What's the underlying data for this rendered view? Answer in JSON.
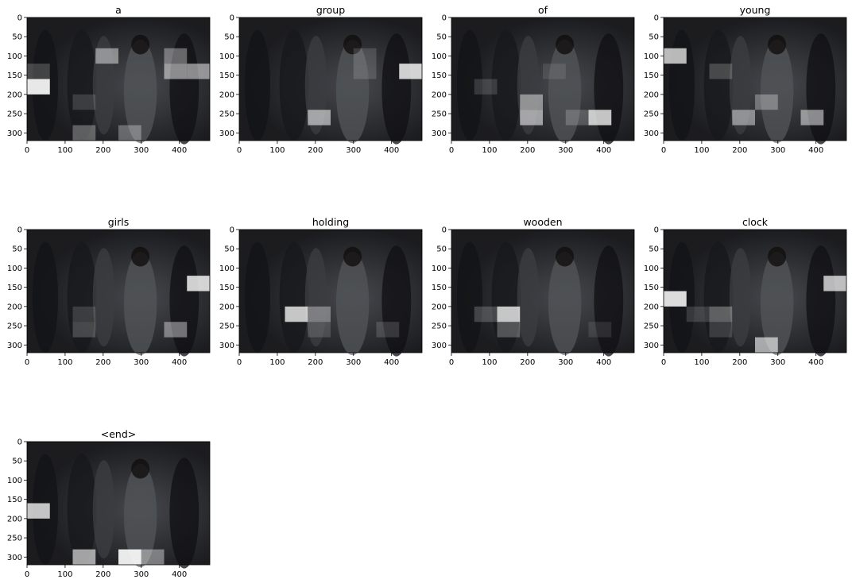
{
  "figure": {
    "background": "#ffffff",
    "layout": {
      "rows": 3,
      "cols": 4
    },
    "image_extent": {
      "x": [
        0,
        480
      ],
      "y": [
        320,
        0
      ]
    },
    "cell_size": 60,
    "grid": false,
    "tick_color": "#000000"
  },
  "chart_data": [
    {
      "type": "heatmap",
      "title": "a",
      "xlabel": "",
      "ylabel": "",
      "xlim": [
        0,
        480
      ],
      "ylim": [
        320,
        0
      ],
      "xticks": [
        0,
        100,
        200,
        300,
        400
      ],
      "yticks": [
        0,
        50,
        100,
        150,
        200,
        250,
        300
      ],
      "highlights": [
        {
          "x": 0,
          "y": 160,
          "w": 60,
          "h": 40,
          "alpha": 0.9
        },
        {
          "x": 180,
          "y": 80,
          "w": 60,
          "h": 40,
          "alpha": 0.45
        },
        {
          "x": 360,
          "y": 80,
          "w": 60,
          "h": 40,
          "alpha": 0.35
        },
        {
          "x": 360,
          "y": 120,
          "w": 60,
          "h": 40,
          "alpha": 0.5
        },
        {
          "x": 420,
          "y": 120,
          "w": 60,
          "h": 40,
          "alpha": 0.5
        },
        {
          "x": 0,
          "y": 120,
          "w": 60,
          "h": 40,
          "alpha": 0.2
        },
        {
          "x": 120,
          "y": 200,
          "w": 60,
          "h": 40,
          "alpha": 0.15
        },
        {
          "x": 120,
          "y": 280,
          "w": 60,
          "h": 40,
          "alpha": 0.3
        },
        {
          "x": 240,
          "y": 280,
          "w": 60,
          "h": 40,
          "alpha": 0.3
        }
      ]
    },
    {
      "type": "heatmap",
      "title": "group",
      "xlabel": "",
      "ylabel": "",
      "xlim": [
        0,
        480
      ],
      "ylim": [
        320,
        0
      ],
      "xticks": [
        0,
        100,
        200,
        300,
        400
      ],
      "yticks": [
        0,
        50,
        100,
        150,
        200,
        250,
        300
      ],
      "highlights": [
        {
          "x": 420,
          "y": 120,
          "w": 60,
          "h": 40,
          "alpha": 0.8
        },
        {
          "x": 180,
          "y": 240,
          "w": 60,
          "h": 40,
          "alpha": 0.55
        },
        {
          "x": 300,
          "y": 80,
          "w": 60,
          "h": 40,
          "alpha": 0.15
        },
        {
          "x": 300,
          "y": 120,
          "w": 60,
          "h": 40,
          "alpha": 0.15
        }
      ]
    },
    {
      "type": "heatmap",
      "title": "of",
      "xlabel": "",
      "ylabel": "",
      "xlim": [
        0,
        480
      ],
      "ylim": [
        320,
        0
      ],
      "xticks": [
        0,
        100,
        200,
        300,
        400
      ],
      "yticks": [
        0,
        50,
        100,
        150,
        200,
        250,
        300
      ],
      "highlights": [
        {
          "x": 360,
          "y": 240,
          "w": 60,
          "h": 40,
          "alpha": 0.75
        },
        {
          "x": 180,
          "y": 200,
          "w": 60,
          "h": 40,
          "alpha": 0.45
        },
        {
          "x": 180,
          "y": 240,
          "w": 60,
          "h": 40,
          "alpha": 0.55
        },
        {
          "x": 300,
          "y": 240,
          "w": 60,
          "h": 40,
          "alpha": 0.2
        },
        {
          "x": 60,
          "y": 160,
          "w": 60,
          "h": 40,
          "alpha": 0.15
        },
        {
          "x": 240,
          "y": 120,
          "w": 60,
          "h": 40,
          "alpha": 0.1
        }
      ]
    },
    {
      "type": "heatmap",
      "title": "young",
      "xlabel": "",
      "ylabel": "",
      "xlim": [
        0,
        480
      ],
      "ylim": [
        320,
        0
      ],
      "xticks": [
        0,
        100,
        200,
        300,
        400
      ],
      "yticks": [
        0,
        50,
        100,
        150,
        200,
        250,
        300
      ],
      "highlights": [
        {
          "x": 0,
          "y": 80,
          "w": 60,
          "h": 40,
          "alpha": 0.7
        },
        {
          "x": 360,
          "y": 240,
          "w": 60,
          "h": 40,
          "alpha": 0.5
        },
        {
          "x": 180,
          "y": 240,
          "w": 60,
          "h": 40,
          "alpha": 0.45
        },
        {
          "x": 240,
          "y": 200,
          "w": 60,
          "h": 40,
          "alpha": 0.3
        },
        {
          "x": 120,
          "y": 120,
          "w": 60,
          "h": 40,
          "alpha": 0.2
        }
      ]
    },
    {
      "type": "heatmap",
      "title": "girls",
      "xlabel": "",
      "ylabel": "",
      "xlim": [
        0,
        480
      ],
      "ylim": [
        320,
        0
      ],
      "xticks": [
        0,
        100,
        200,
        300,
        400
      ],
      "yticks": [
        0,
        50,
        100,
        150,
        200,
        250,
        300
      ],
      "highlights": [
        {
          "x": 420,
          "y": 120,
          "w": 60,
          "h": 40,
          "alpha": 0.8
        },
        {
          "x": 360,
          "y": 240,
          "w": 60,
          "h": 40,
          "alpha": 0.4
        },
        {
          "x": 120,
          "y": 240,
          "w": 60,
          "h": 40,
          "alpha": 0.2
        },
        {
          "x": 120,
          "y": 200,
          "w": 60,
          "h": 40,
          "alpha": 0.15
        }
      ]
    },
    {
      "type": "heatmap",
      "title": "holding",
      "xlabel": "",
      "ylabel": "",
      "xlim": [
        0,
        480
      ],
      "ylim": [
        320,
        0
      ],
      "xticks": [
        0,
        100,
        200,
        300,
        400
      ],
      "yticks": [
        0,
        50,
        100,
        150,
        200,
        250,
        300
      ],
      "highlights": [
        {
          "x": 120,
          "y": 200,
          "w": 60,
          "h": 40,
          "alpha": 0.75
        },
        {
          "x": 180,
          "y": 200,
          "w": 60,
          "h": 40,
          "alpha": 0.35
        },
        {
          "x": 180,
          "y": 240,
          "w": 60,
          "h": 40,
          "alpha": 0.15
        },
        {
          "x": 360,
          "y": 240,
          "w": 60,
          "h": 40,
          "alpha": 0.15
        }
      ]
    },
    {
      "type": "heatmap",
      "title": "wooden",
      "xlabel": "",
      "ylabel": "",
      "xlim": [
        0,
        480
      ],
      "ylim": [
        320,
        0
      ],
      "xticks": [
        0,
        100,
        200,
        300,
        400
      ],
      "yticks": [
        0,
        50,
        100,
        150,
        200,
        250,
        300
      ],
      "highlights": [
        {
          "x": 120,
          "y": 200,
          "w": 60,
          "h": 40,
          "alpha": 0.75
        },
        {
          "x": 60,
          "y": 200,
          "w": 60,
          "h": 40,
          "alpha": 0.2
        },
        {
          "x": 120,
          "y": 240,
          "w": 60,
          "h": 40,
          "alpha": 0.25
        },
        {
          "x": 360,
          "y": 240,
          "w": 60,
          "h": 40,
          "alpha": 0.1
        }
      ]
    },
    {
      "type": "heatmap",
      "title": "clock",
      "xlabel": "",
      "ylabel": "",
      "xlim": [
        0,
        480
      ],
      "ylim": [
        320,
        0
      ],
      "xticks": [
        0,
        100,
        200,
        300,
        400
      ],
      "yticks": [
        0,
        50,
        100,
        150,
        200,
        250,
        300
      ],
      "highlights": [
        {
          "x": 0,
          "y": 160,
          "w": 60,
          "h": 40,
          "alpha": 0.85
        },
        {
          "x": 420,
          "y": 120,
          "w": 60,
          "h": 40,
          "alpha": 0.7
        },
        {
          "x": 240,
          "y": 280,
          "w": 60,
          "h": 40,
          "alpha": 0.6
        },
        {
          "x": 120,
          "y": 200,
          "w": 60,
          "h": 40,
          "alpha": 0.3
        },
        {
          "x": 60,
          "y": 200,
          "w": 60,
          "h": 40,
          "alpha": 0.15
        },
        {
          "x": 120,
          "y": 240,
          "w": 60,
          "h": 40,
          "alpha": 0.15
        }
      ]
    },
    {
      "type": "heatmap",
      "title": "<end>",
      "xlabel": "",
      "ylabel": "",
      "xlim": [
        0,
        480
      ],
      "ylim": [
        320,
        0
      ],
      "xticks": [
        0,
        100,
        200,
        300,
        400
      ],
      "yticks": [
        0,
        50,
        100,
        150,
        200,
        250,
        300
      ],
      "highlights": [
        {
          "x": 240,
          "y": 280,
          "w": 60,
          "h": 40,
          "alpha": 0.9
        },
        {
          "x": 0,
          "y": 160,
          "w": 60,
          "h": 40,
          "alpha": 0.75
        },
        {
          "x": 120,
          "y": 280,
          "w": 60,
          "h": 40,
          "alpha": 0.6
        },
        {
          "x": 300,
          "y": 280,
          "w": 60,
          "h": 40,
          "alpha": 0.4
        }
      ]
    }
  ]
}
